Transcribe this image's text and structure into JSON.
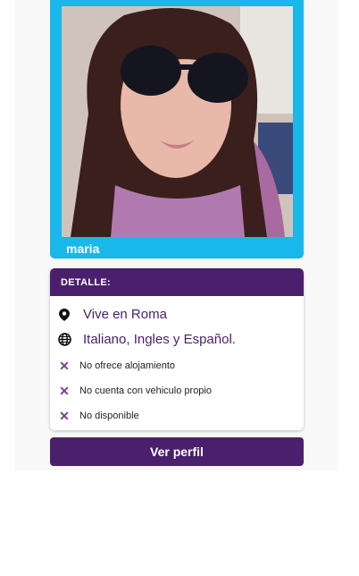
{
  "profile": {
    "name": "maria"
  },
  "detail": {
    "header": "DETALLE:",
    "location": {
      "icon": "location-pin-icon",
      "text": "Vive en Roma"
    },
    "languages": {
      "icon": "globe-icon",
      "text": "Italiano, Ingles y Español."
    },
    "items": [
      {
        "icon": "cross-icon",
        "text": "No ofrece alojamiento"
      },
      {
        "icon": "cross-icon",
        "text": "No cuenta con vehiculo propio"
      },
      {
        "icon": "cross-icon",
        "text": "No disponible"
      }
    ]
  },
  "actions": {
    "view_profile_label": "Ver perfil"
  },
  "colors": {
    "accent_purple": "#4a1f6b",
    "photo_border": "#1ab7ea"
  }
}
